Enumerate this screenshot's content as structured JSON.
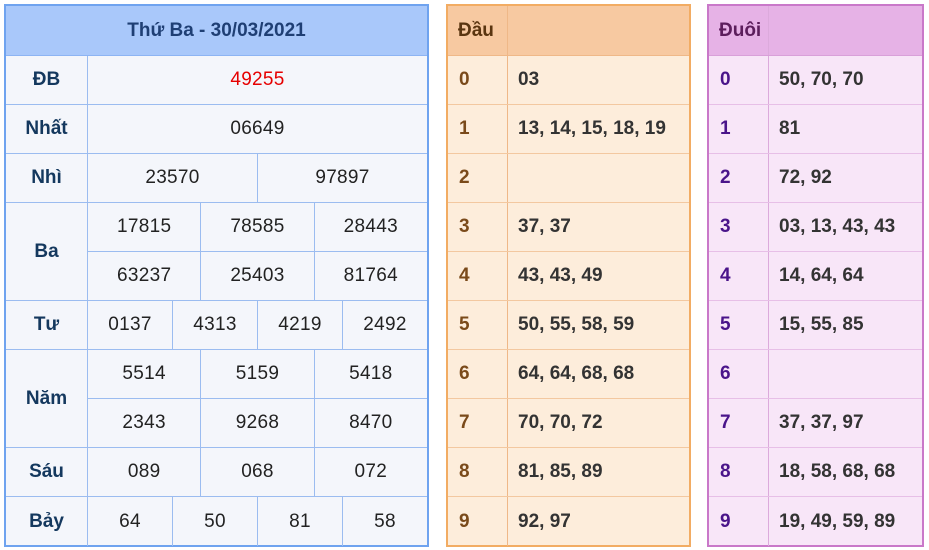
{
  "results": {
    "title": "Thứ Ba - 30/03/2021",
    "rows": [
      {
        "label": "ĐB",
        "lines": [
          [
            "49255"
          ]
        ]
      },
      {
        "label": "Nhất",
        "lines": [
          [
            "06649"
          ]
        ]
      },
      {
        "label": "Nhì",
        "lines": [
          [
            "23570",
            "97897"
          ]
        ]
      },
      {
        "label": "Ba",
        "lines": [
          [
            "17815",
            "78585",
            "28443"
          ],
          [
            "63237",
            "25403",
            "81764"
          ]
        ]
      },
      {
        "label": "Tư",
        "lines": [
          [
            "0137",
            "4313",
            "4219",
            "2492"
          ]
        ]
      },
      {
        "label": "Năm",
        "lines": [
          [
            "5514",
            "5159",
            "5418"
          ],
          [
            "2343",
            "9268",
            "8470"
          ]
        ]
      },
      {
        "label": "Sáu",
        "lines": [
          [
            "089",
            "068",
            "072"
          ]
        ]
      },
      {
        "label": "Bảy",
        "lines": [
          [
            "64",
            "50",
            "81",
            "58"
          ]
        ]
      }
    ],
    "special_color": "#e60000"
  },
  "dau": {
    "header": "Đầu",
    "rows": [
      {
        "key": "0",
        "value": "03"
      },
      {
        "key": "1",
        "value": "13, 14, 15, 18, 19"
      },
      {
        "key": "2",
        "value": ""
      },
      {
        "key": "3",
        "value": "37, 37"
      },
      {
        "key": "4",
        "value": "43, 43, 49"
      },
      {
        "key": "5",
        "value": "50, 55, 58, 59"
      },
      {
        "key": "6",
        "value": "64, 64, 68, 68"
      },
      {
        "key": "7",
        "value": "70, 70, 72"
      },
      {
        "key": "8",
        "value": "81, 85, 89"
      },
      {
        "key": "9",
        "value": "92, 97"
      }
    ]
  },
  "duoi": {
    "header": "Đuôi",
    "rows": [
      {
        "key": "0",
        "value": "50, 70, 70"
      },
      {
        "key": "1",
        "value": "81"
      },
      {
        "key": "2",
        "value": "72, 92"
      },
      {
        "key": "3",
        "value": "03, 13, 43, 43"
      },
      {
        "key": "4",
        "value": "14, 64, 64"
      },
      {
        "key": "5",
        "value": "15, 55, 85"
      },
      {
        "key": "6",
        "value": ""
      },
      {
        "key": "7",
        "value": "37, 37, 97"
      },
      {
        "key": "8",
        "value": "18, 58, 68, 68"
      },
      {
        "key": "9",
        "value": "19, 49, 59, 89"
      }
    ]
  }
}
